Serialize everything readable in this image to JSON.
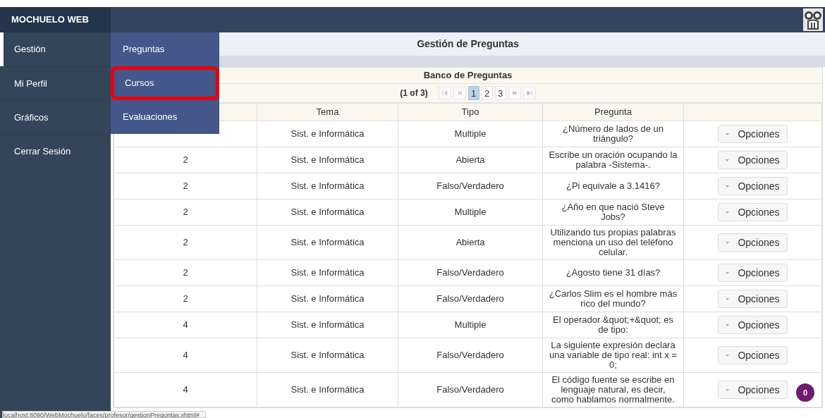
{
  "brand": "MOCHUELO WEB",
  "sidebar": {
    "items": [
      {
        "label": "Gestión",
        "selected": true
      },
      {
        "label": "Mi Perfil",
        "selected": false
      },
      {
        "label": "Gráficos",
        "selected": false
      },
      {
        "label": "Cerrar Sesión",
        "selected": false
      }
    ]
  },
  "submenu": {
    "items": [
      {
        "label": "Preguntas",
        "highlighted": false
      },
      {
        "label": "Cursos",
        "highlighted": true
      },
      {
        "label": "Evaluaciones",
        "highlighted": false
      }
    ]
  },
  "page_title": "Gestión de Preguntas",
  "table": {
    "caption": "Banco de Preguntas",
    "paginator": {
      "report": "(1 of 3)",
      "pages": [
        {
          "label": "1",
          "selected": true
        },
        {
          "label": "2",
          "selected": false
        },
        {
          "label": "3",
          "selected": false
        }
      ]
    },
    "columns": [
      "Tema",
      "Tipo",
      "Pregunta"
    ],
    "rows": [
      {
        "tema": "Sist. e Informática",
        "tipo": "Multiple",
        "pregunta": "¿Número de lados de un triángulo?",
        "action": "Opciones"
      },
      {
        "column_1": "2",
        "tema": "Sist. e Informática",
        "tipo": "Abierta",
        "pregunta": "Escribe un oración ocupando la palabra -Sistema-.",
        "action": "Opciones"
      },
      {
        "column_1": "2",
        "tema": "Sist. e Informática",
        "tipo": "Falso/Verdadero",
        "pregunta": "¿Pi equivale a 3.1416?",
        "action": "Opciones"
      },
      {
        "column_1": "2",
        "tema": "Sist. e Informática",
        "tipo": "Multiple",
        "pregunta": "¿Año en que nació Steve Jobs?",
        "action": "Opciones"
      },
      {
        "column_1": "2",
        "tema": "Sist. e Informática",
        "tipo": "Abierta",
        "pregunta": "Utilizando tus propias palabras menciona un uso del teléfono celular.",
        "action": "Opciones"
      },
      {
        "column_1": "2",
        "tema": "Sist. e Informática",
        "tipo": "Falso/Verdadero",
        "pregunta": "¿Agosto tiene 31 días?",
        "action": "Opciones"
      },
      {
        "column_1": "2",
        "tema": "Sist. e Informática",
        "tipo": "Falso/Verdadero",
        "pregunta": "¿Carlos Slim es el hombre más rico del mundo?",
        "action": "Opciones"
      },
      {
        "column_1": "4",
        "tema": "Sist. e Informática",
        "tipo": "Multiple",
        "pregunta": "El operador &quot;+&quot; es de tipo:",
        "action": "Opciones"
      },
      {
        "column_1": "4",
        "tema": "Sist. e Informática",
        "tipo": "Falso/Verdadero",
        "pregunta": "La siguiente expresión declara una variable de tipo real: int x = 0;",
        "action": "Opciones"
      },
      {
        "column_1": "4",
        "tema": "Sist. e Informática",
        "tipo": "Falso/Verdadero",
        "pregunta": "El código fuente se escribe en lenguaje natural, es decir, como hablamos normalmente.",
        "action": "Opciones"
      }
    ]
  },
  "notification_badge": "0",
  "status_url": "localhost:8090/WebMochuelo/faces/profesor/gestionPreguntas.xhtml#"
}
